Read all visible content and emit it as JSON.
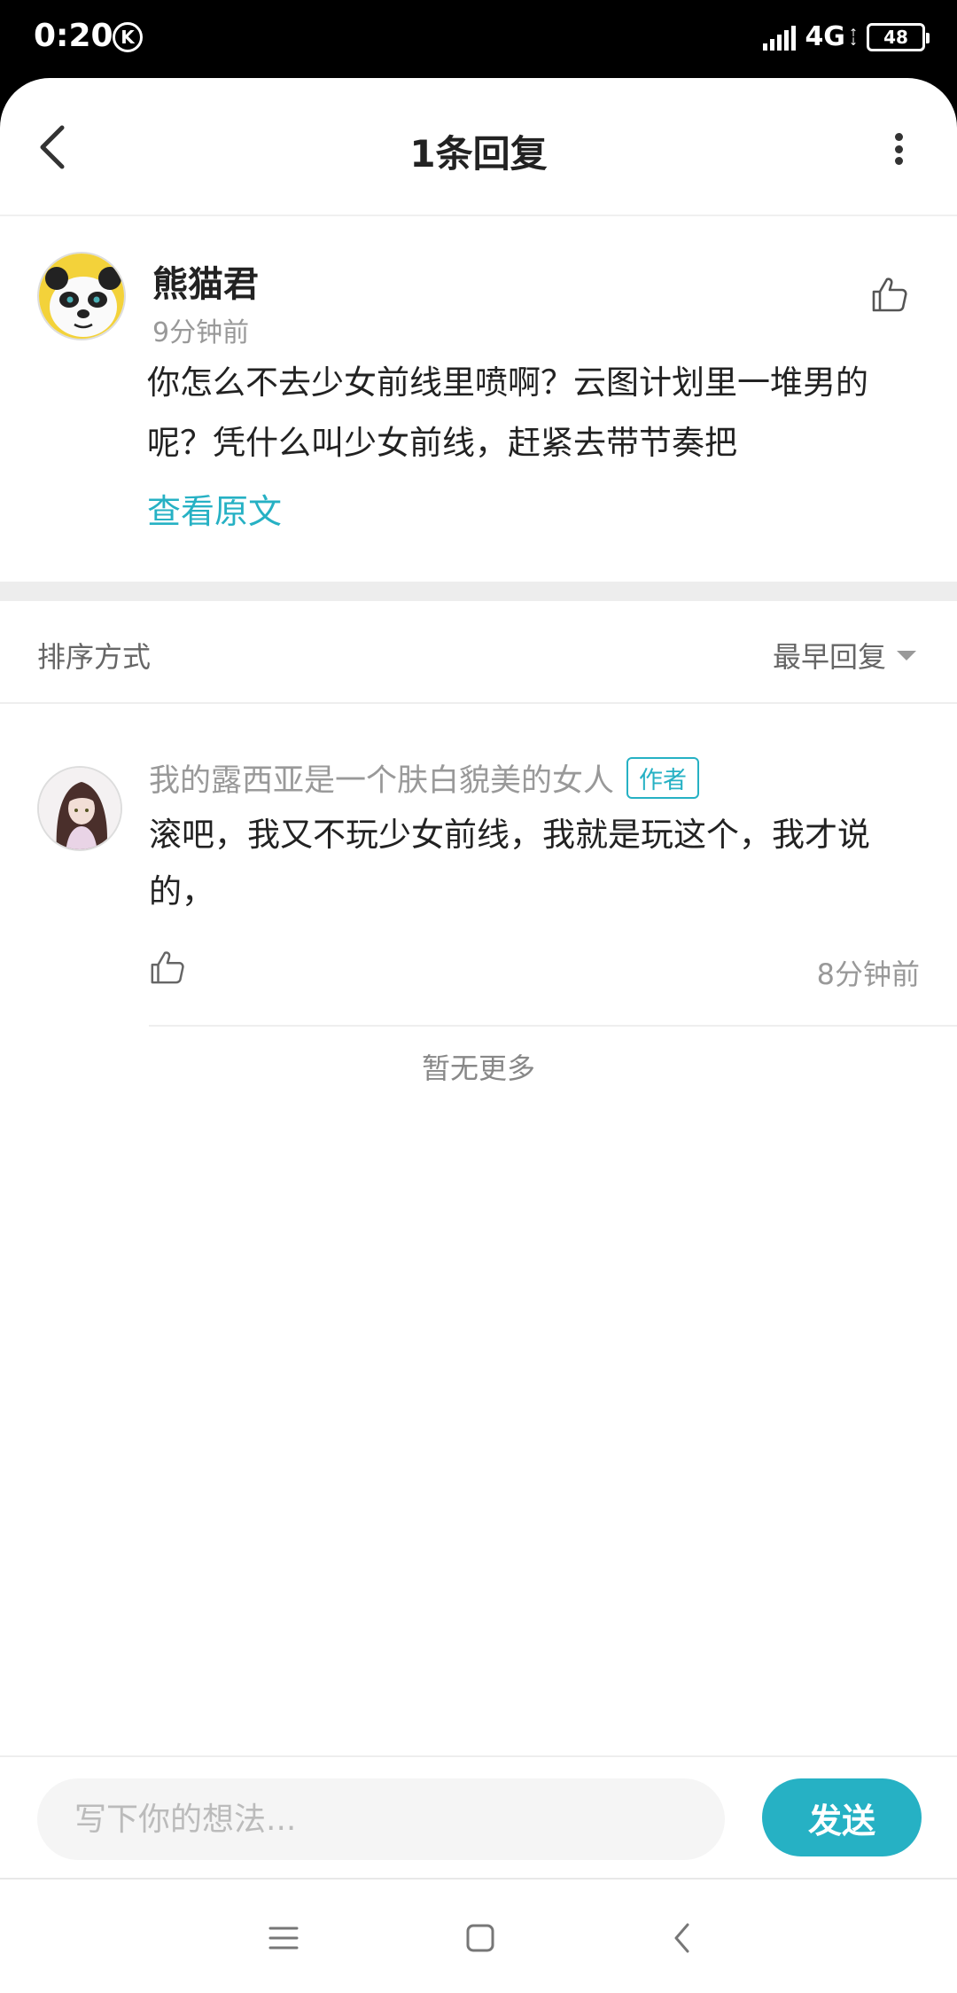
{
  "status_bar": {
    "time": "0:20",
    "k_badge": "K",
    "network": "4G",
    "battery": "48"
  },
  "header": {
    "title": "1条回复"
  },
  "original_comment": {
    "author": "熊猫君",
    "time": "9分钟前",
    "text": "你怎么不去少女前线里喷啊？云图计划里一堆男的呢？凭什么叫少女前线，赶紧去带节奏把",
    "view_original_label": "查看原文",
    "avatar_icon": "panda-avatar-icon"
  },
  "sort": {
    "label": "排序方式",
    "value": "最早回复"
  },
  "replies": [
    {
      "author": "我的露西亚是一个肤白貌美的女人",
      "tag": "作者",
      "text": "滚吧，我又不玩少女前线，我就是玩这个，我才说的，",
      "time": "8分钟前",
      "avatar_icon": "anime-girl-avatar-icon"
    }
  ],
  "no_more_label": "暂无更多",
  "input_bar": {
    "placeholder": "写下你的想法...",
    "send_label": "发送"
  },
  "colors": {
    "accent": "#26b1c4",
    "text_primary": "#222222",
    "text_secondary": "#999999",
    "divider": "#ededed"
  }
}
